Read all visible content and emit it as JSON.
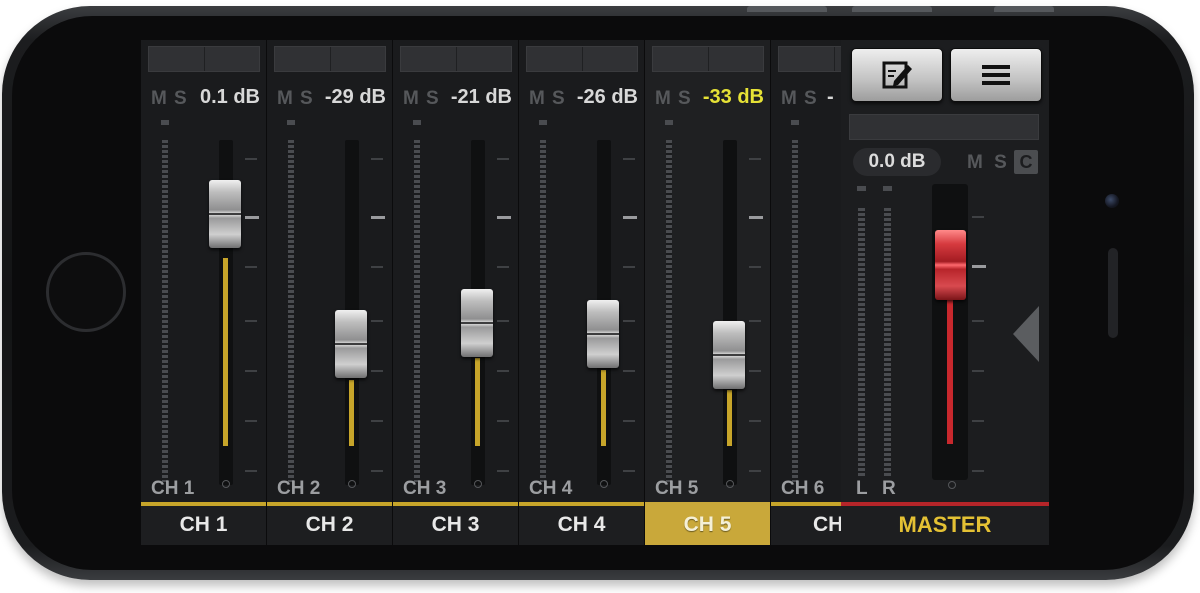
{
  "channels": [
    {
      "strip_label": "CH 1",
      "tab_label": "CH 1",
      "mute": "M",
      "solo": "S",
      "level": "0.1 dB",
      "fader_level": 0.78,
      "active": false
    },
    {
      "strip_label": "CH 2",
      "tab_label": "CH 2",
      "mute": "M",
      "solo": "S",
      "level": "-29 dB",
      "fader_level": 0.28,
      "active": false
    },
    {
      "strip_label": "CH 3",
      "tab_label": "CH 3",
      "mute": "M",
      "solo": "S",
      "level": "-21 dB",
      "fader_level": 0.4,
      "active": false
    },
    {
      "strip_label": "CH 4",
      "tab_label": "CH 4",
      "mute": "M",
      "solo": "S",
      "level": "-26 dB",
      "fader_level": 0.35,
      "active": false
    },
    {
      "strip_label": "CH 5",
      "tab_label": "CH 5",
      "mute": "M",
      "solo": "S",
      "level": "-33 dB",
      "fader_level": 0.21,
      "active": true
    },
    {
      "strip_label": "CH 6",
      "tab_label": "CH",
      "mute": "M",
      "solo": "S",
      "level": "-",
      "active": false
    }
  ],
  "master": {
    "tab_label": "MASTER",
    "level": "0.0 dB",
    "mute": "M",
    "solo": "S",
    "clip": "C",
    "left_label": "L",
    "right_label": "R",
    "fader_level": 0.78
  },
  "toolbar": {
    "edit_icon": "edit-note-icon",
    "menu_icon": "hamburger-menu-icon"
  },
  "colors": {
    "accent": "#c7a52a",
    "active_tab": "#c9a83a",
    "highlight_level": "#e6e236",
    "master_accent": "#b52529",
    "master_label": "#e4c134"
  }
}
